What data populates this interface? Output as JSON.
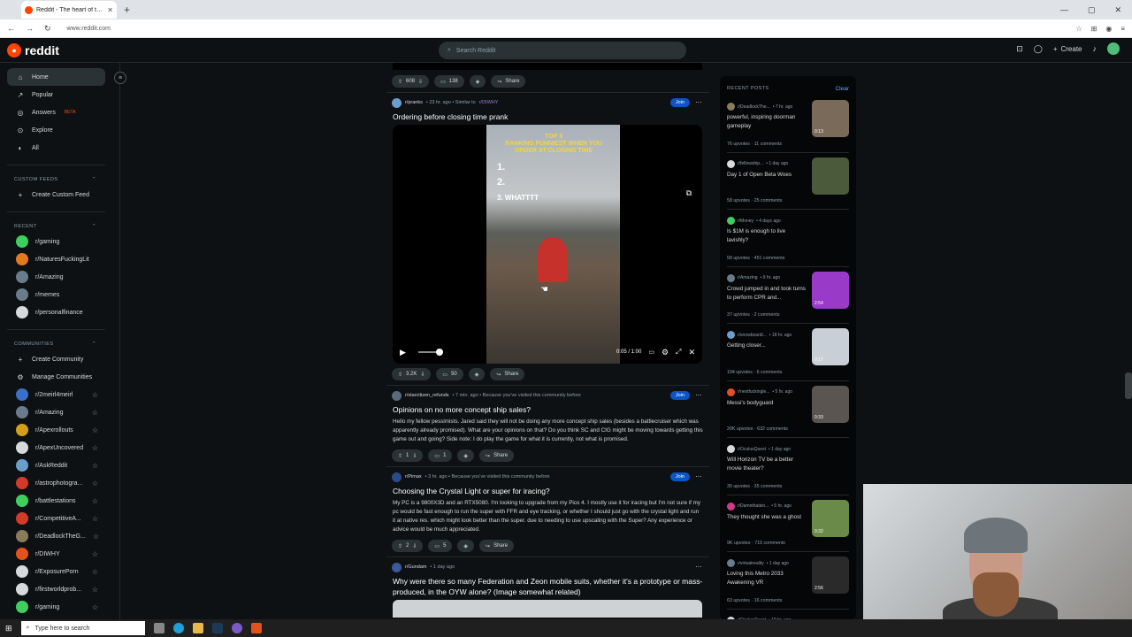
{
  "browser": {
    "tab_title": "Reddit - The heart of the intern",
    "url": "www.reddit.com",
    "new_tab": "+",
    "window_controls": [
      "—",
      "▢",
      "✕"
    ]
  },
  "header": {
    "logo_text": "reddit",
    "search_placeholder": "Search Reddit",
    "create_label": "Create"
  },
  "sidebar": {
    "nav": [
      {
        "label": "Home",
        "icon": "home-icon",
        "glyph": "⌂"
      },
      {
        "label": "Popular",
        "icon": "popular-icon",
        "glyph": "↗"
      },
      {
        "label": "Answers",
        "icon": "answers-icon",
        "glyph": "◎",
        "badge": "BETA"
      },
      {
        "label": "Explore",
        "icon": "explore-icon",
        "glyph": "⊙"
      },
      {
        "label": "All",
        "icon": "all-icon",
        "glyph": "◐"
      }
    ],
    "custom_feeds_title": "CUSTOM FEEDS",
    "create_custom_feed": "Create Custom Feed",
    "recent_title": "RECENT",
    "recent": [
      {
        "label": "r/gaming",
        "color": "#3ecf5e"
      },
      {
        "label": "r/NaturesFuckingLit",
        "color": "#e37a1c"
      },
      {
        "label": "r/Amazing",
        "color": "#6a7c8c"
      },
      {
        "label": "r/memes",
        "color": "#6a7c8c"
      },
      {
        "label": "r/personalfinance",
        "color": "#d7dadc"
      }
    ],
    "communities_title": "COMMUNITIES",
    "create_community": "Create Community",
    "manage_communities": "Manage Communities",
    "communities": [
      {
        "label": "r/2meirl4meirl",
        "color": "#3a70c9"
      },
      {
        "label": "r/Amazing",
        "color": "#6a7c8c"
      },
      {
        "label": "r/Apexrollouts",
        "color": "#d4a017"
      },
      {
        "label": "r/ApexUncovered",
        "color": "#d7dadc"
      },
      {
        "label": "r/AskReddit",
        "color": "#6a9fcb"
      },
      {
        "label": "r/astrophotogra...",
        "color": "#d23a2a"
      },
      {
        "label": "r/battlestations",
        "color": "#3ecf5e"
      },
      {
        "label": "r/CompetitiveA...",
        "color": "#d23a2a"
      },
      {
        "label": "r/DeadlockTheG...",
        "color": "#8a7b5c"
      },
      {
        "label": "r/DIWHY",
        "color": "#e3511c"
      },
      {
        "label": "r/ExposurePorn",
        "color": "#d7dadc"
      },
      {
        "label": "r/firstworldprob...",
        "color": "#d7dadc"
      },
      {
        "label": "r/gaming",
        "color": "#3ecf5e"
      }
    ]
  },
  "feed": {
    "top_actions": {
      "votes": "608",
      "comments": "138",
      "share": "Share"
    },
    "posts": [
      {
        "sub": "r/pranks",
        "meta": "• 23 hr. ago • Similar to",
        "similar": "r/DIWHY",
        "title": "Ordering before closing time prank",
        "join": "Join",
        "video_top": "TOP 3",
        "video_caption": "RANKING FUNNIEST WHEN YOU ORDER AT CLOSING TIME",
        "video_list": [
          "1.",
          "2.",
          "3. WHATTTT"
        ],
        "time": "0:05 / 1:00",
        "votes": "3.2K",
        "comments": "50",
        "share": "Share"
      },
      {
        "sub": "r/starcitizen_refunds",
        "meta": "• 7 min. ago • Because you've visited this community before",
        "title": "Opinions on no more concept ship sales?",
        "body": "Hello my fellow pessimists. Jared said they will not be doing any more concept ship sales (besides a battlecruiser which was apparently already promised). What are your opinions on that? Do you think SC and CIG might be moving towards getting this game out and going? Side note: I do play the game for what it is currently, not what is promised.",
        "join": "Join",
        "votes": "1",
        "comments": "1",
        "share": "Share"
      },
      {
        "sub": "r/Pimax",
        "meta": "• 3 hr. ago • Because you've visited this community before",
        "title": "Choosing the Crystal Light or super for iracing?",
        "body": "My PC is a 9800X3D and an RTX5080. I'm looking to upgrade from my Pico 4. I mostly use it for iracing but I'm not sure if my pc would be fast enough to run the super with FFR and eye tracking, or whether I should just go with the crystal light and run it at native res. which might look better than the super. due to needing to use upscaling with the Super? Any experience or advice would be much appreciated.",
        "join": "Join",
        "votes": "2",
        "comments": "5",
        "share": "Share"
      },
      {
        "sub": "r/Gundam",
        "meta": "• 1 day ago",
        "title": "Why were there so many Federation and Zeon mobile suits, whether it's a prototype or mass-produced, in the OYW alone? (Image somewhat related)"
      }
    ]
  },
  "recent_posts": {
    "title": "RECENT POSTS",
    "clear": "Clear",
    "items": [
      {
        "sub": "r/DeadlockThe...",
        "age": "• 7 hr. ago",
        "title": "powerful, inspiring doorman gameplay",
        "stats": "76 upvotes · 11 comments",
        "thumb": "#7a6a5a",
        "dur": "0:13",
        "icon": "#8a7b5c"
      },
      {
        "sub": "r/fellowship...",
        "age": "• 1 day ago",
        "title": "Day 1 of Open Beta Woes",
        "stats": "58 upvotes · 25 comments",
        "thumb": "#4a5a3a",
        "dur": "",
        "icon": "#d7dadc"
      },
      {
        "sub": "r/Money",
        "age": "• 4 days ago",
        "title": "Is $1M is enough to live lavishly?",
        "stats": "58 upvotes · 451 comments",
        "thumb": "",
        "dur": "",
        "icon": "#3ecf5e"
      },
      {
        "sub": "r/Amazing",
        "age": "• 9 hr. ago",
        "title": "Crowd jumped in and took turns to perform CPR and...",
        "stats": "37 upvotes · 2 comments",
        "thumb": "#9a3ac9",
        "dur": "2:54",
        "icon": "#6a7c8c"
      },
      {
        "sub": "r/snowboardi...",
        "age": "• 18 hr. ago",
        "title": "Getting closer...",
        "stats": "104 upvotes · 6 comments",
        "thumb": "#c8cfd6",
        "dur": "0:17",
        "icon": "#6a9fcb"
      },
      {
        "sub": "r/nextfuckingle...",
        "age": "• 5 hr. ago",
        "title": "Messi's bodyguard",
        "stats": "20K upvotes · 632 comments",
        "thumb": "#5a5550",
        "dur": "0:33",
        "icon": "#e3511c"
      },
      {
        "sub": "r/OculusQuest",
        "age": "• 1 day ago",
        "title": "Will Horizon TV be a better movie theater?",
        "stats": "35 upvotes · 35 comments",
        "thumb": "",
        "dur": "",
        "icon": "#d7dadc"
      },
      {
        "sub": "r/Damnthatsin...",
        "age": "• 5 hr. ago",
        "title": "They thought she was a ghost",
        "stats": "9K upvotes · 715 comments",
        "thumb": "#6a8a4a",
        "dur": "0:32",
        "icon": "#d23a8a"
      },
      {
        "sub": "r/virtualreality",
        "age": "• 1 day ago",
        "title": "Loving this Metro 2033 Awakening VR",
        "stats": "63 upvotes · 16 comments",
        "thumb": "#2a2a2a",
        "dur": "2:56",
        "icon": "#6a7c8c"
      },
      {
        "sub": "r/OculusQuest",
        "age": "• 19 hr. ago",
        "title": "One game before I move on",
        "stats": "",
        "thumb": "",
        "dur": "",
        "icon": "#d7dadc"
      }
    ]
  },
  "taskbar": {
    "search_placeholder": "Type here to search"
  }
}
